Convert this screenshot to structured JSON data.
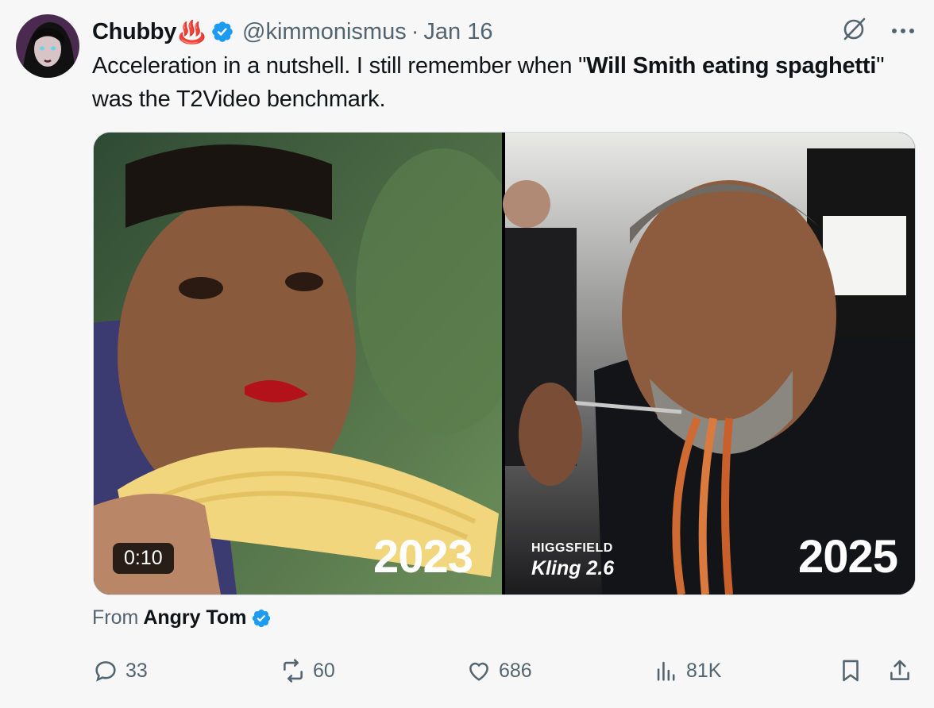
{
  "author": {
    "name": "Chubby",
    "emoji": "♨️",
    "handle": "@kimmonismus",
    "separator": "·",
    "date": "Jan 16"
  },
  "tweet": {
    "text_part1": "Acceleration in a nutshell. I still remember when \"",
    "text_bold": "Will Smith eating spaghetti",
    "text_part2": "\" was the T2Video benchmark."
  },
  "media": {
    "duration": "0:10",
    "left_year": "2023",
    "right_year": "2025",
    "brand_top": "HIGGSFIELD",
    "brand_bottom": "Kling 2.6"
  },
  "source": {
    "prefix": "From",
    "name": "Angry Tom"
  },
  "stats": {
    "replies": "33",
    "reposts": "60",
    "likes": "686",
    "views": "81K"
  },
  "colors": {
    "verified": "#1d9bf0",
    "muted": "#536471",
    "hot_springs": "#e0245e"
  }
}
